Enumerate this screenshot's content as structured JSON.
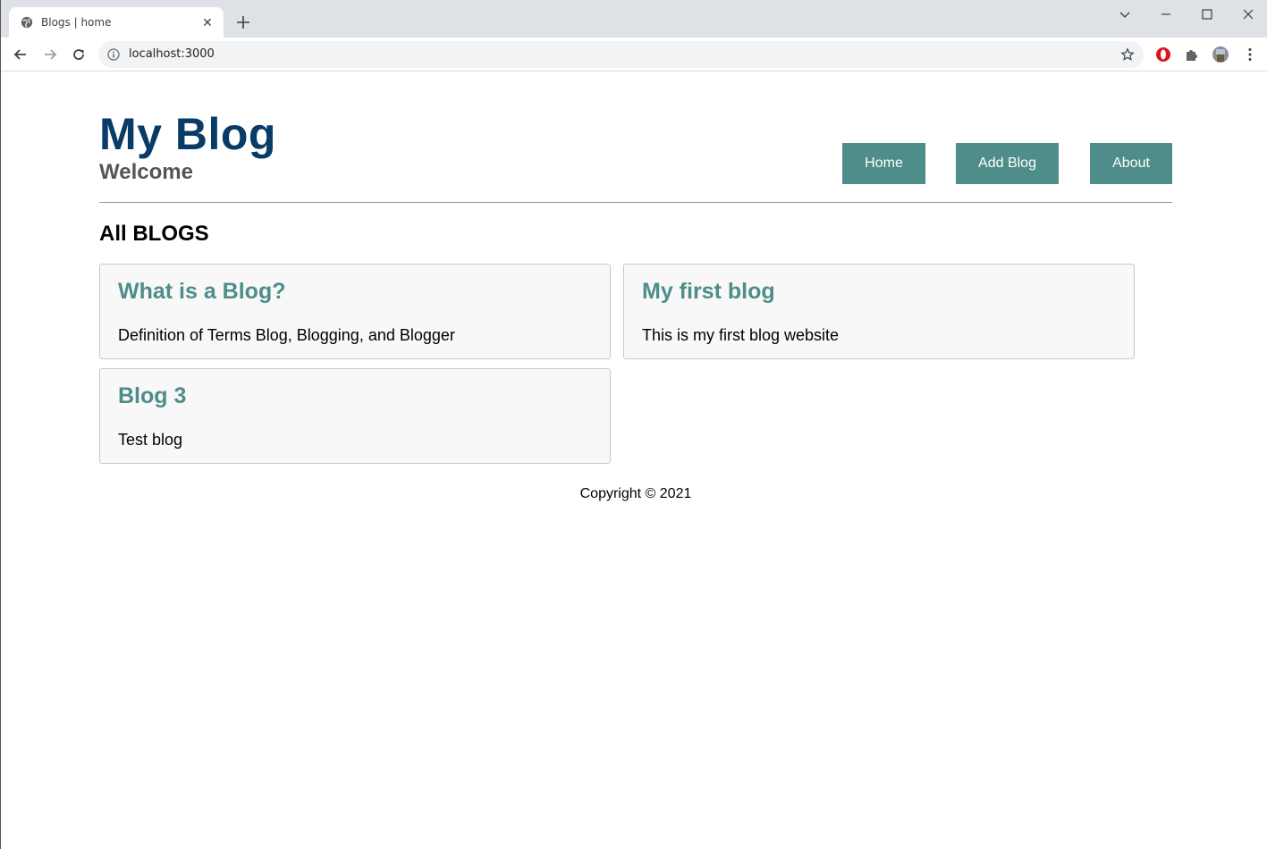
{
  "browser": {
    "tab_title": "Blogs | home",
    "url": "localhost:3000"
  },
  "site": {
    "title": "My Blog",
    "subtitle": "Welcome",
    "nav": [
      "Home",
      "Add Blog",
      "About"
    ],
    "section_title": "All BLOGS",
    "blogs": [
      {
        "title": "What is a Blog?",
        "description": "Definition of Terms Blog, Blogging, and Blogger"
      },
      {
        "title": "My first blog",
        "description": "This is my first blog website"
      },
      {
        "title": "Blog 3",
        "description": "Test blog"
      }
    ],
    "footer": "Copyright © 2021"
  },
  "colors": {
    "title": "#083b66",
    "accent": "#4e8d8a",
    "subtitle": "#555555"
  },
  "icons": {
    "tab": "globe-icon",
    "toolbar": [
      "back-arrow-icon",
      "forward-arrow-icon",
      "reload-icon",
      "info-icon",
      "star-icon",
      "opera-icon",
      "puzzle-icon",
      "avatar",
      "kebab-menu-icon"
    ]
  }
}
